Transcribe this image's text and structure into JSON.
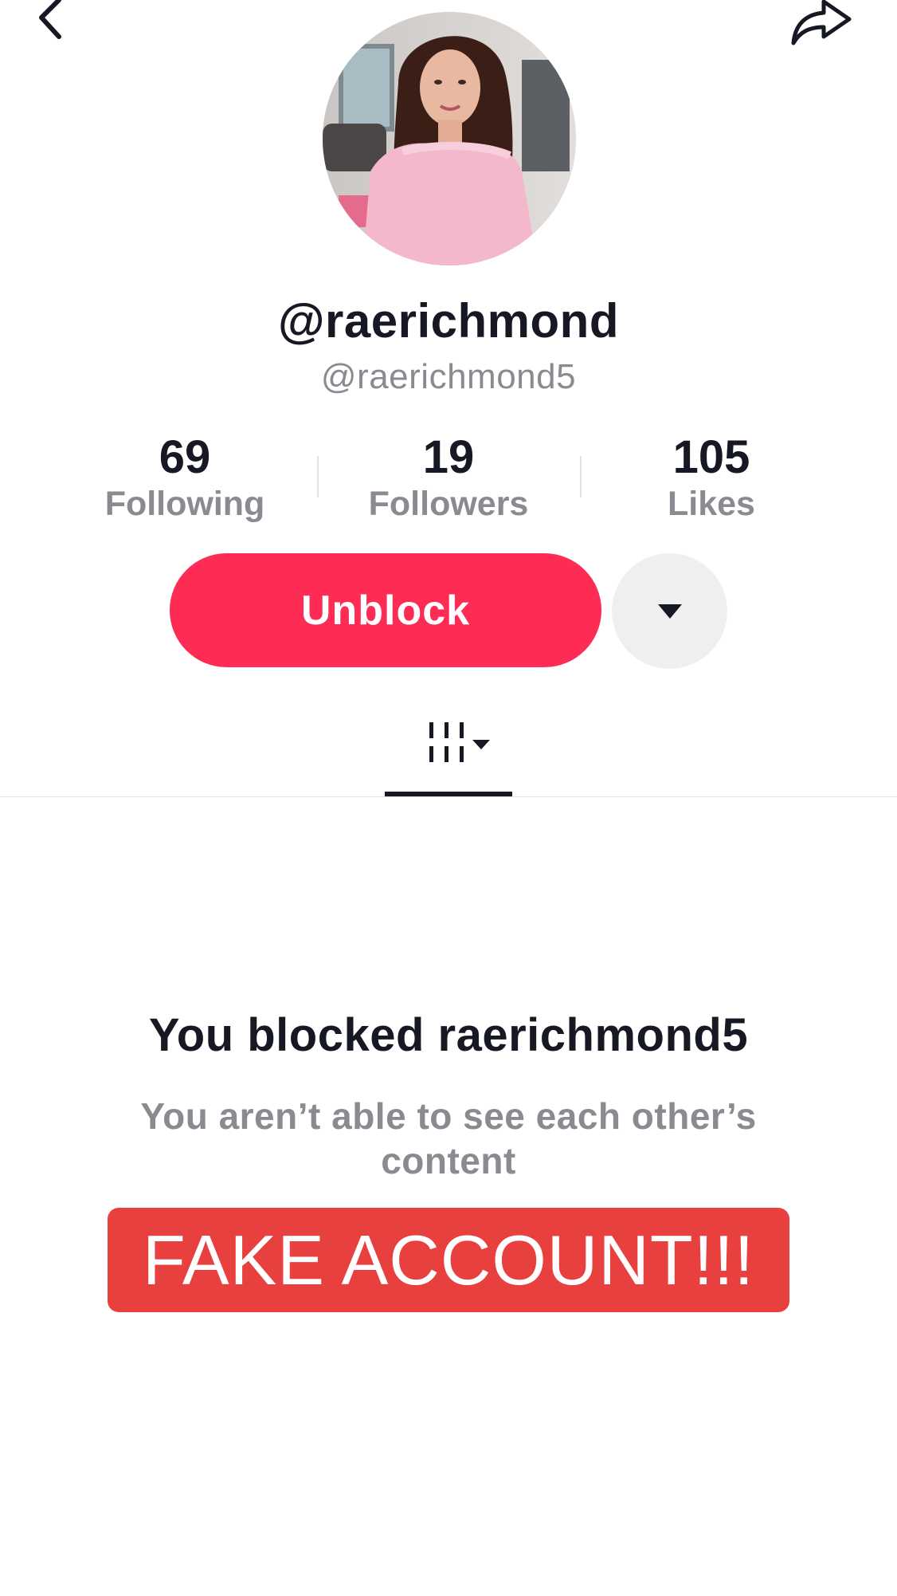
{
  "profile": {
    "display_name": "@raerichmond",
    "username": "@raerichmond5",
    "avatar_description": "profile-photo"
  },
  "stats": [
    {
      "value": "69",
      "label": "Following"
    },
    {
      "value": "19",
      "label": "Followers"
    },
    {
      "value": "105",
      "label": "Likes"
    }
  ],
  "actions": {
    "unblock_label": "Unblock",
    "more_icon": "caret-down-icon"
  },
  "tabs": {
    "videos_icon": "grid-icon"
  },
  "blocked": {
    "title": "You blocked raerichmond5",
    "subtitle": "You aren’t able to see each other’s content"
  },
  "overlay": {
    "banner_text": "FAKE ACCOUNT!!!"
  },
  "colors": {
    "accent": "#fe2c55",
    "banner": "#e8403f",
    "muted_text": "#8a8b91"
  }
}
